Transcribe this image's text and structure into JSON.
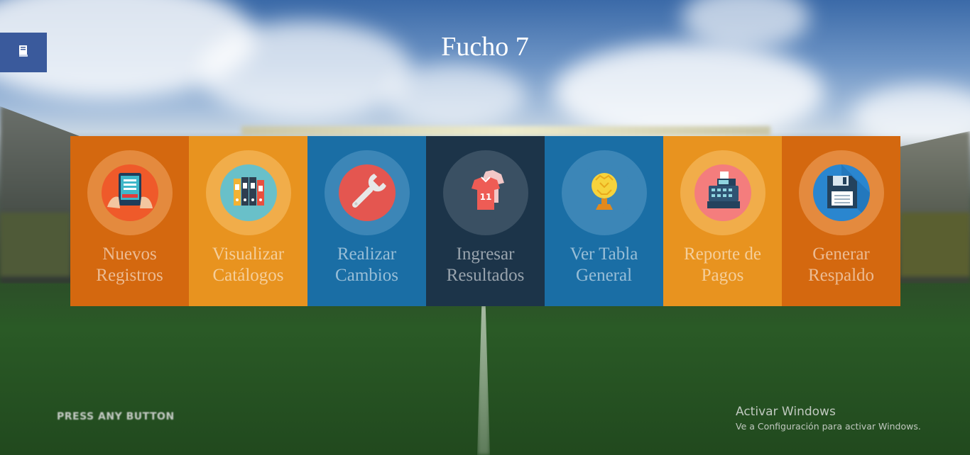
{
  "app": {
    "title": "Fucho 7"
  },
  "menu_button": {
    "icon": "notebook-icon"
  },
  "tiles": [
    {
      "label": "Nuevos Registros",
      "icon": "tablet-register-icon",
      "colors": {
        "bg": "#d4680f",
        "ring": "#e48a3e",
        "circle": "#ef5a2a"
      }
    },
    {
      "label": "Visualizar Catálogos",
      "icon": "binders-icon",
      "colors": {
        "bg": "#e8931f",
        "ring": "#f1ad4a",
        "circle": "#69c0c9"
      }
    },
    {
      "label": "Realizar Cambios",
      "icon": "wrench-icon",
      "colors": {
        "bg": "#1a6ea5",
        "ring": "#3c86b7",
        "circle": "#e45650"
      }
    },
    {
      "label": "Ingresar Resultados",
      "icon": "jersey-icon",
      "colors": {
        "bg": "#1c3449",
        "ring": "#3a5063",
        "circle": "#3a5063"
      }
    },
    {
      "label": "Ver Tabla General",
      "icon": "trophy-icon",
      "colors": {
        "bg": "#1a6ea5",
        "ring": "#3c86b7",
        "circle": "#3c86b7"
      }
    },
    {
      "label": "Reporte de Pagos",
      "icon": "cash-register-icon",
      "colors": {
        "bg": "#e8931f",
        "ring": "#f1ad4a",
        "circle": "#f47d7d"
      }
    },
    {
      "label": "Generar Respaldo",
      "icon": "floppy-disk-icon",
      "colors": {
        "bg": "#d4680f",
        "ring": "#e48a3e",
        "circle": "#2a86cf"
      }
    }
  ],
  "background": {
    "press_prompt": "PRESS ANY BUTTON"
  },
  "watermark": {
    "title": "Activar Windows",
    "subtitle": "Ve a Configuración para activar Windows."
  }
}
